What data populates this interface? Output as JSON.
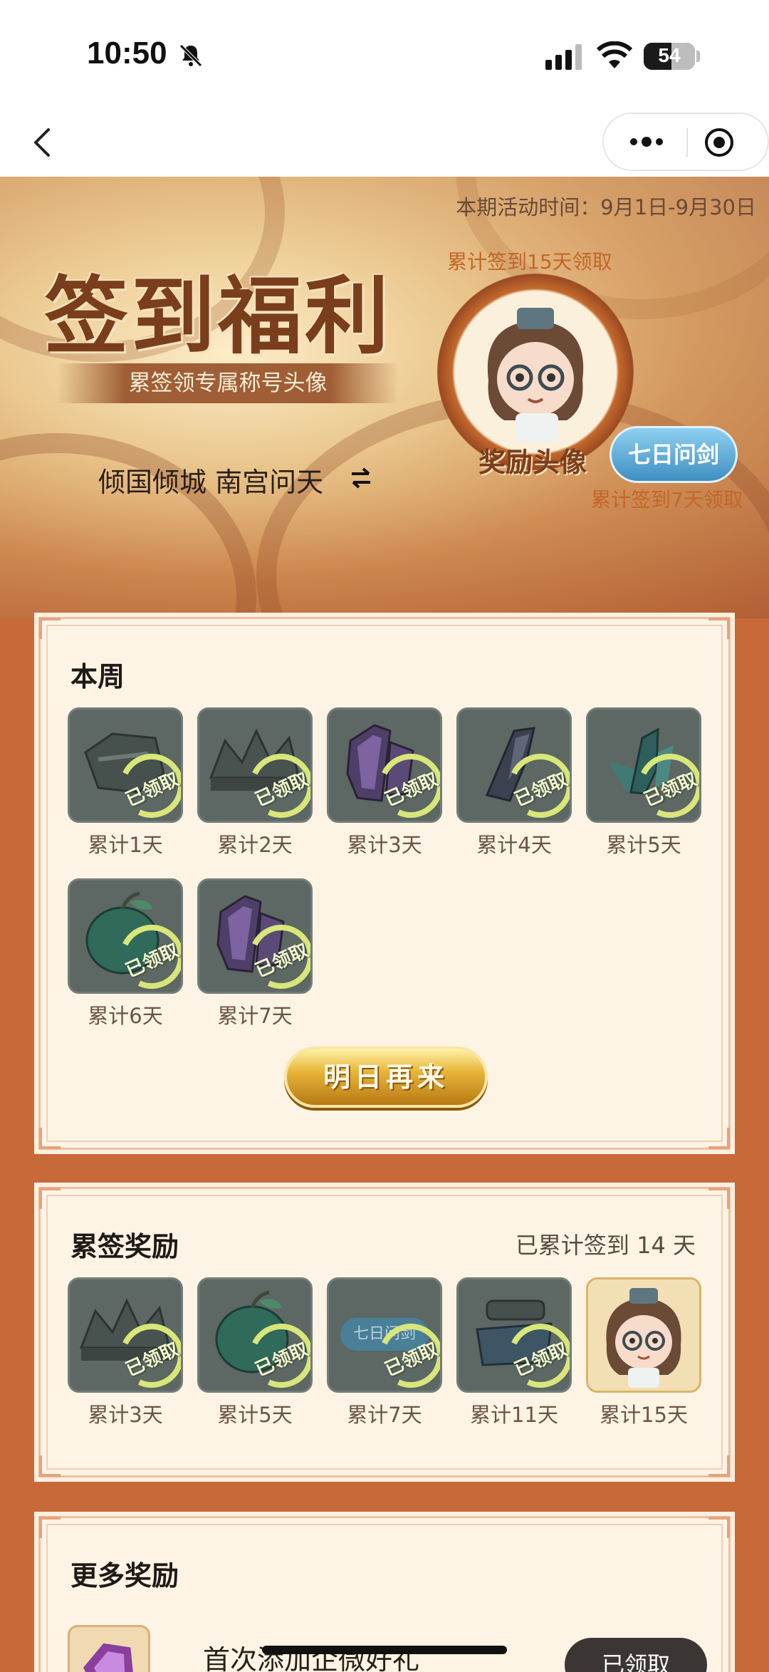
{
  "status_bar": {
    "time": "10:50",
    "battery": "54"
  },
  "banner": {
    "activity_time": "本期活动时间：9月1日-9月30日",
    "title": "签到福利",
    "subtitle": "累签领专属称号头像",
    "user_name": "倾国倾城 南宫问天",
    "avatar_requirement": "累计签到15天领取",
    "avatar_label": "奖励头像",
    "title_badge": "七日问剑",
    "badge_requirement": "累计签到7天领取"
  },
  "weekly": {
    "title": "本周",
    "claimed_text": "已领取",
    "items": [
      {
        "label": "累计1天",
        "icon": "grey-armor-icon"
      },
      {
        "label": "累计2天",
        "icon": "grey-crown-icon"
      },
      {
        "label": "累计3天",
        "icon": "purple-crystal-icon"
      },
      {
        "label": "累计4天",
        "icon": "dark-crystal-icon"
      },
      {
        "label": "累计5天",
        "icon": "teal-leaf-icon"
      },
      {
        "label": "累计6天",
        "icon": "green-fruit-icon"
      },
      {
        "label": "累计7天",
        "icon": "purple-crystal-icon"
      }
    ],
    "button_label": "明日再来"
  },
  "cumulative": {
    "title": "累签奖励",
    "progress_text": "已累计签到 14 天",
    "claimed_text": "已领取",
    "items": [
      {
        "label": "累计3天",
        "icon": "grey-crown-icon",
        "claimed": true
      },
      {
        "label": "累计5天",
        "icon": "green-fruit-icon",
        "claimed": true
      },
      {
        "label": "累计7天",
        "icon": "title-badge-icon",
        "claimed": true,
        "badge_text": "七日问剑"
      },
      {
        "label": "累计11天",
        "icon": "grey-scroll-icon",
        "claimed": true
      },
      {
        "label": "累计15天",
        "icon": "avatar-icon",
        "claimed": false
      }
    ]
  },
  "more": {
    "title": "更多奖励",
    "item_title": "首次添加企微好礼",
    "item_button": "已领取"
  }
}
